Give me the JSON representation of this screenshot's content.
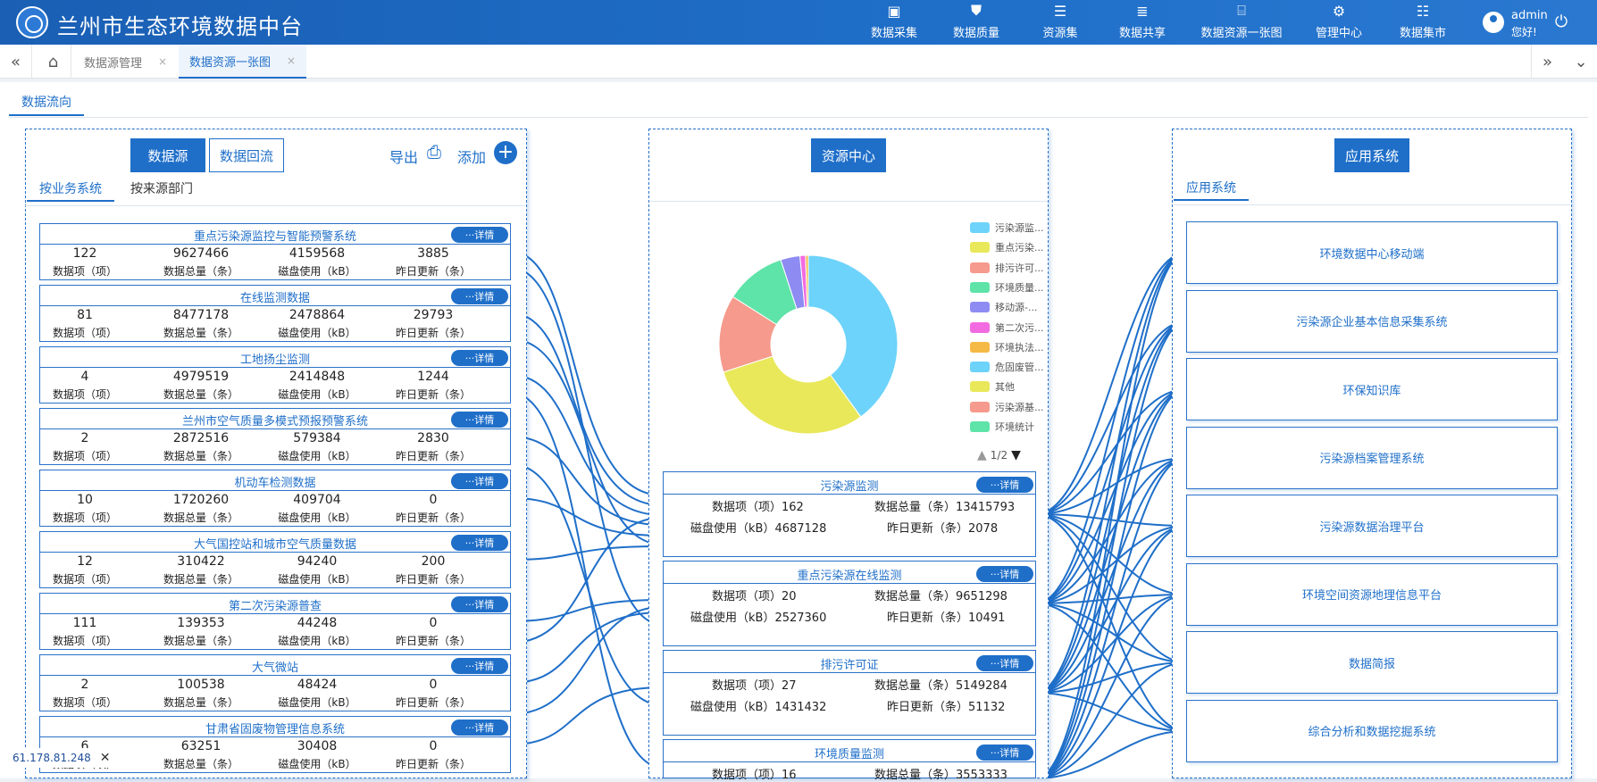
{
  "header": {
    "title": "兰州市生态环境数据中台",
    "nav": [
      {
        "label": "数据采集",
        "icon": "chart-icon"
      },
      {
        "label": "数据质量",
        "icon": "badge-icon"
      },
      {
        "label": "资源集",
        "icon": "database-icon"
      },
      {
        "label": "数据共享",
        "icon": "server-icon"
      },
      {
        "label": "数据资源一张图",
        "icon": "map-icon"
      },
      {
        "label": "管理中心",
        "icon": "gear-icon"
      },
      {
        "label": "数据集市",
        "icon": "stack-icon"
      }
    ],
    "user": {
      "name": "admin",
      "greeting": "您好!"
    }
  },
  "tabs": [
    {
      "label": "数据源管理",
      "close": "×"
    },
    {
      "label": "数据资源一张图",
      "close": "×"
    }
  ],
  "section": {
    "title": "数据流向"
  },
  "left": {
    "btn_source": "数据源",
    "btn_backflow": "数据回流",
    "export": "导出",
    "add": "添加",
    "subtab_business": "按业务系统",
    "subtab_dept": "按来源部门",
    "detail_label": "···详情",
    "labels": [
      "数据项（项）",
      "数据总量（条）",
      "磁盘使用（kB）",
      "昨日更新（条）"
    ],
    "cards": [
      {
        "title": "重点污染源监控与智能预警系统",
        "values": [
          "122",
          "9627466",
          "4159568",
          "3885"
        ]
      },
      {
        "title": "在线监测数据",
        "values": [
          "81",
          "8477178",
          "2478864",
          "29793"
        ]
      },
      {
        "title": "工地扬尘监测",
        "values": [
          "4",
          "4979519",
          "2414848",
          "1244"
        ]
      },
      {
        "title": "兰州市空气质量多模式预报预警系统",
        "values": [
          "2",
          "2872516",
          "579384",
          "2830"
        ]
      },
      {
        "title": "机动车检测数据",
        "values": [
          "10",
          "1720260",
          "409704",
          "0"
        ]
      },
      {
        "title": "大气国控站和城市空气质量数据",
        "values": [
          "12",
          "310422",
          "94240",
          "200"
        ]
      },
      {
        "title": "第二次污染源普查",
        "values": [
          "111",
          "139353",
          "44248",
          "0"
        ]
      },
      {
        "title": "大气微站",
        "values": [
          "2",
          "100538",
          "48424",
          "0"
        ]
      },
      {
        "title": "甘肃省固废物管理信息系统",
        "values": [
          "6",
          "63251",
          "30408",
          "0"
        ]
      }
    ]
  },
  "center": {
    "btn": "资源中心",
    "pager": "1/2",
    "legend": [
      {
        "label": "污染源监...",
        "color": "#6dd3fa"
      },
      {
        "label": "重点污染...",
        "color": "#e8e85a"
      },
      {
        "label": "排污许可...",
        "color": "#f59a8c"
      },
      {
        "label": "环境质量...",
        "color": "#5ee3a8"
      },
      {
        "label": "移动源-...",
        "color": "#8e8cf2"
      },
      {
        "label": "第二次污...",
        "color": "#f36be0"
      },
      {
        "label": "环境执法...",
        "color": "#f5b945"
      },
      {
        "label": "危固废管...",
        "color": "#6dd3fa"
      },
      {
        "label": "其他",
        "color": "#e8e85a"
      },
      {
        "label": "污染源基...",
        "color": "#f59a8c"
      },
      {
        "label": "环境统计",
        "color": "#5ee3a8"
      }
    ],
    "pie": [
      {
        "label": "污染源监...",
        "value": 40.0,
        "color": "#6dd3fa"
      },
      {
        "label": "重点污染...",
        "value": 30.0,
        "color": "#e8e85a"
      },
      {
        "label": "排污许可...",
        "value": 14.0,
        "color": "#f59a8c"
      },
      {
        "label": "环境质量...",
        "value": 11.0,
        "color": "#5ee3a8"
      },
      {
        "label": "移动源-...",
        "value": 3.5,
        "color": "#8e8cf2"
      },
      {
        "label": "第二次污...",
        "value": 1.0,
        "color": "#f36be0"
      },
      {
        "label": "环境执法...",
        "value": 0.5,
        "color": "#f5b945"
      }
    ],
    "cards": [
      {
        "title": "污染源监测",
        "items": "数据项（项）162",
        "total": "数据总量（条）13415793",
        "disk": "磁盘使用（kB）4687128",
        "update": "昨日更新（条）2078"
      },
      {
        "title": "重点污染源在线监测",
        "items": "数据项（项）20",
        "total": "数据总量（条）9651298",
        "disk": "磁盘使用（kB）2527360",
        "update": "昨日更新（条）10491"
      },
      {
        "title": "排污许可证",
        "items": "数据项（项）27",
        "total": "数据总量（条）5149284",
        "disk": "磁盘使用（kB）1431432",
        "update": "昨日更新（条）51132"
      },
      {
        "title": "环境质量监测",
        "items": "数据项（项）16",
        "total": "数据总量（条）3553333",
        "disk": "",
        "update": ""
      }
    ]
  },
  "right": {
    "btn": "应用系统",
    "subtab": "应用系统",
    "apps": [
      "环境数据中心移动端",
      "污染源企业基本信息采集系统",
      "环保知识库",
      "污染源档案管理系统",
      "污染源数据治理平台",
      "环境空间资源地理信息平台",
      "数据简报",
      "综合分析和数据挖掘系统"
    ]
  },
  "footer": {
    "ip": "61.178.81.248",
    "close": "✕"
  }
}
